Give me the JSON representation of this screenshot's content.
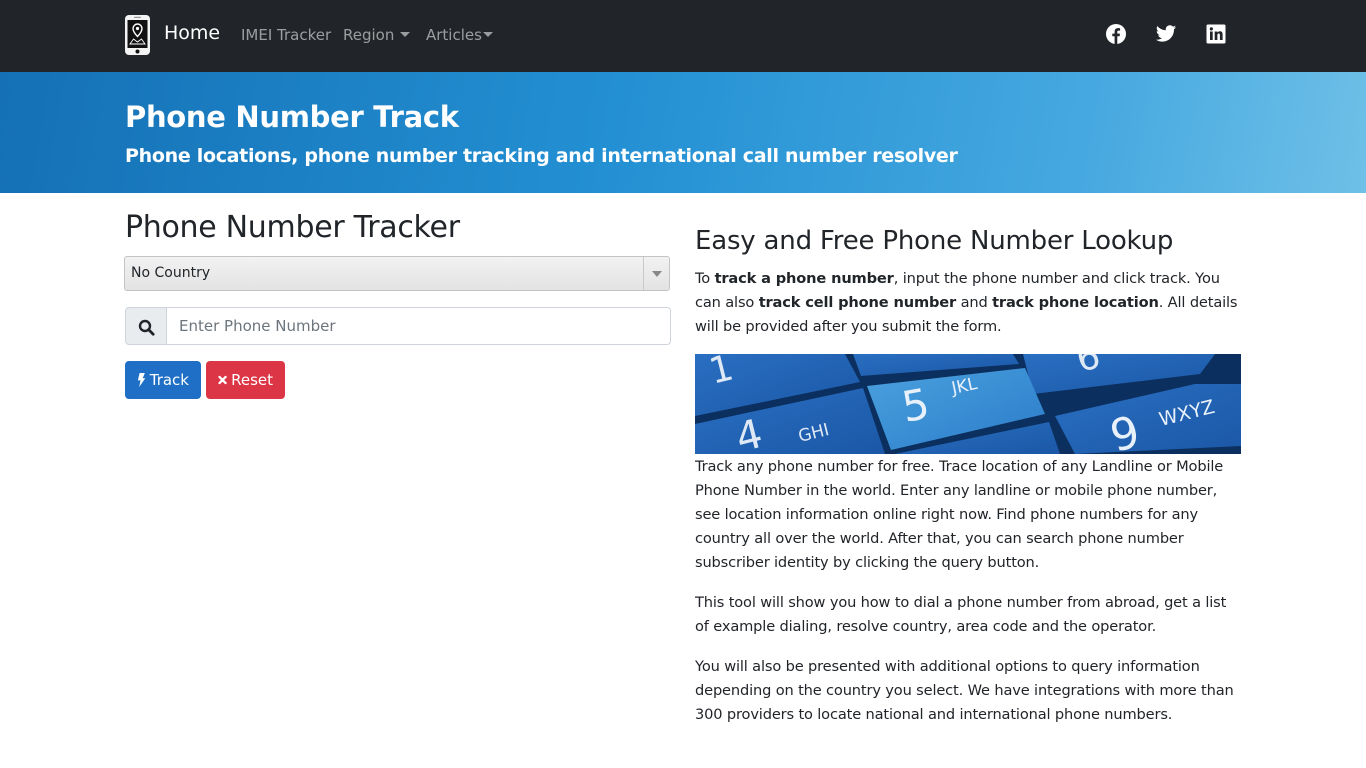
{
  "navbar": {
    "brand_label": "Home",
    "links": [
      {
        "label": "IMEI Tracker",
        "dropdown": false
      },
      {
        "label": "Region",
        "dropdown": true
      },
      {
        "label": "Articles",
        "dropdown": true
      }
    ],
    "social": [
      "facebook-icon",
      "twitter-icon",
      "linkedin-icon"
    ]
  },
  "hero": {
    "title": "Phone Number Track",
    "subtitle": "Phone locations, phone number tracking and international call number resolver"
  },
  "tracker": {
    "title": "Phone Number Tracker",
    "country_select_value": "No Country",
    "phone_input_value": "",
    "phone_input_placeholder": "Enter Phone Number",
    "track_label": "Track",
    "reset_label": "Reset"
  },
  "lookup": {
    "title": "Easy and Free Phone Number Lookup",
    "intro": {
      "t1": "To ",
      "b1": "track a phone number",
      "t2": ", input the phone number and click track. You can also ",
      "b2": "track cell phone number",
      "t3": " and ",
      "b3": "track phone location",
      "t4": ". All details will be provided after you submit the form."
    },
    "image_keys": [
      {
        "digit": "1",
        "letters": ""
      },
      {
        "digit": "4",
        "letters": "GHI"
      },
      {
        "digit": "5",
        "letters": "JKL"
      },
      {
        "digit": "6",
        "letters": ""
      },
      {
        "digit": "9",
        "letters": "WXYZ"
      }
    ],
    "paragraphs": [
      "Track any phone number for free. Trace location of any Landline or Mobile Phone Number in the world. Enter any landline or mobile phone number, see location information online right now. Find phone numbers for any country all over the world. After that, you can search phone number subscriber identity by clicking the query button.",
      "This tool will show you how to dial a phone number from abroad, get a list of example dialing, resolve country, area code and the operator.",
      "You will also be presented with additional options to query information depending on the country you select. We have integrations with more than 300 providers to locate national and international phone numbers."
    ]
  },
  "colors": {
    "navbar_bg": "#212529",
    "hero_gradient_start": "#1570b5",
    "hero_gradient_end": "#6ec0e7",
    "track_button": "#1e6fc5",
    "reset_button": "#dc3545"
  }
}
